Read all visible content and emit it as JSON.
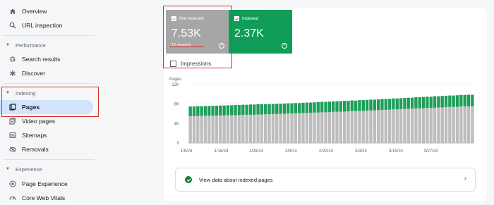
{
  "sidebar": {
    "overview": "Overview",
    "url_inspection": "URL inspection",
    "performance_section": "Performance",
    "search_results": "Search results",
    "discover": "Discover",
    "indexing_section": "Indexing",
    "pages": "Pages",
    "video_pages": "Video pages",
    "sitemaps": "Sitemaps",
    "removals": "Removals",
    "experience_section": "Experience",
    "page_experience": "Page Experience",
    "core_web_vitals": "Core Web Vitals"
  },
  "metrics": {
    "not_indexed": {
      "label": "Not indexed",
      "value": "7.53K",
      "sub": "12 reasons",
      "color": "#a6a6a6"
    },
    "indexed": {
      "label": "Indexed",
      "value": "2.37K",
      "color": "#0f9d58"
    }
  },
  "impressions_label": "Impressions",
  "info_row_text": "View data about indexed pages",
  "chart_data": {
    "type": "bar",
    "stacked": true,
    "ylabel": "Pages",
    "ylim": [
      0,
      12000
    ],
    "yticks": [
      "0",
      "4K",
      "8K",
      "12K"
    ],
    "x_tick_labels": [
      "1/5/24",
      "1/16/24",
      "1/28/24",
      "2/9/24",
      "2/20/24",
      "3/3/24",
      "3/15/24",
      "3/27/24"
    ],
    "series": [
      {
        "name": "Not indexed",
        "color": "#bdbdbd",
        "values": [
          5500,
          5500,
          5550,
          5550,
          5600,
          5600,
          5600,
          5650,
          5650,
          5650,
          5700,
          5700,
          5700,
          5750,
          5750,
          5800,
          5800,
          5800,
          5850,
          5850,
          5900,
          5900,
          5950,
          5950,
          6000,
          6000,
          6050,
          6050,
          6100,
          6100,
          6150,
          6150,
          6200,
          6250,
          6250,
          6300,
          6300,
          6350,
          6400,
          6400,
          6450,
          6450,
          6500,
          6550,
          6550,
          6600,
          6600,
          6650,
          6700,
          6700,
          6750,
          6800,
          6800,
          6850,
          6900,
          6900,
          6950,
          7000,
          7000,
          7050,
          7100,
          7100,
          7150,
          7200,
          7200,
          7250,
          7300,
          7300,
          7350,
          7400,
          7400,
          7450,
          7500,
          7500,
          7530,
          7530
        ]
      },
      {
        "name": "Indexed",
        "color": "#1e9e5a",
        "values": [
          2000,
          2000,
          2000,
          2000,
          2000,
          2000,
          2050,
          2000,
          2050,
          2050,
          2050,
          2050,
          2100,
          2050,
          2100,
          2050,
          2100,
          2100,
          2100,
          2100,
          2050,
          2100,
          2050,
          2100,
          2050,
          2100,
          2100,
          2100,
          2100,
          2100,
          2100,
          2150,
          2100,
          2100,
          2150,
          2150,
          2150,
          2150,
          2150,
          2150,
          2150,
          2200,
          2150,
          2200,
          2150,
          2200,
          2200,
          2200,
          2200,
          2200,
          2200,
          2200,
          2250,
          2200,
          2250,
          2250,
          2250,
          2250,
          2300,
          2250,
          2300,
          2300,
          2300,
          2300,
          2300,
          2350,
          2300,
          2350,
          2350,
          2350,
          2350,
          2350,
          2370,
          2370,
          2370,
          2370
        ]
      }
    ]
  }
}
